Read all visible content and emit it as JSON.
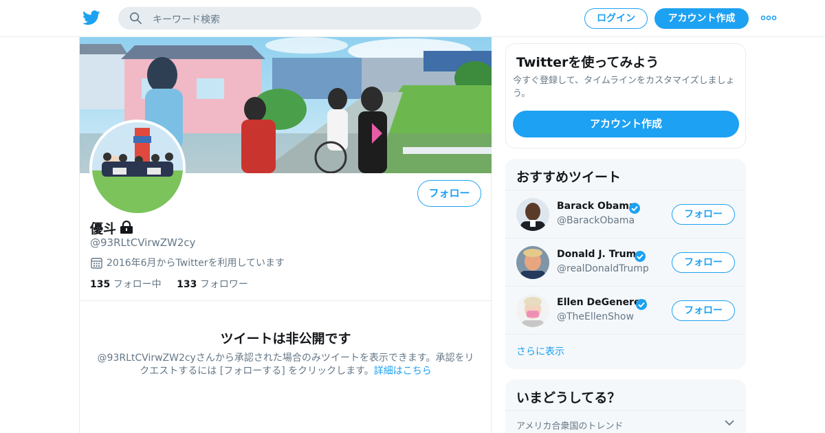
{
  "header": {
    "search_placeholder": "キーワード検索",
    "login_label": "ログイン",
    "signup_label": "アカウント作成"
  },
  "profile": {
    "name": "優斗",
    "handle": "@93RLtCVirwZW2cy",
    "joined": "2016年6月からTwitterを利用しています",
    "following_count": "135",
    "following_label": "フォロー中",
    "followers_count": "133",
    "followers_label": "フォロワー",
    "follow_label": "フォロー",
    "protected_title": "ツイートは非公開です",
    "protected_desc": "@93RLtCVirwZW2cyさんから承認された場合のみツイートを表示できます。承認をリクエストするには [フォローする] をクリックします。",
    "learn_more": "詳細はこちら"
  },
  "signup_card": {
    "title": "Twitterを使ってみよう",
    "description": "今すぐ登録して、タイムラインをカスタマイズしましょう。",
    "button": "アカウント作成"
  },
  "recommended": {
    "title": "おすすめツイート",
    "accounts": [
      {
        "name": "Barack Obama",
        "handle": "@BarackObama",
        "follow": "フォロー"
      },
      {
        "name": "Donald J. Trump",
        "handle": "@realDonaldTrump",
        "follow": "フォロー"
      },
      {
        "name": "Ellen DeGeneres",
        "handle": "@TheEllenShow",
        "follow": "フォロー"
      }
    ],
    "show_more": "さらに表示"
  },
  "trends": {
    "title": "いまどうしてる？",
    "region": "アメリカ合衆国のトレンド"
  },
  "colors": {
    "accent": "#1da1f2",
    "text": "#14171a",
    "muted": "#657786",
    "border": "#e6ecf0",
    "panel": "#f5f8fa"
  }
}
